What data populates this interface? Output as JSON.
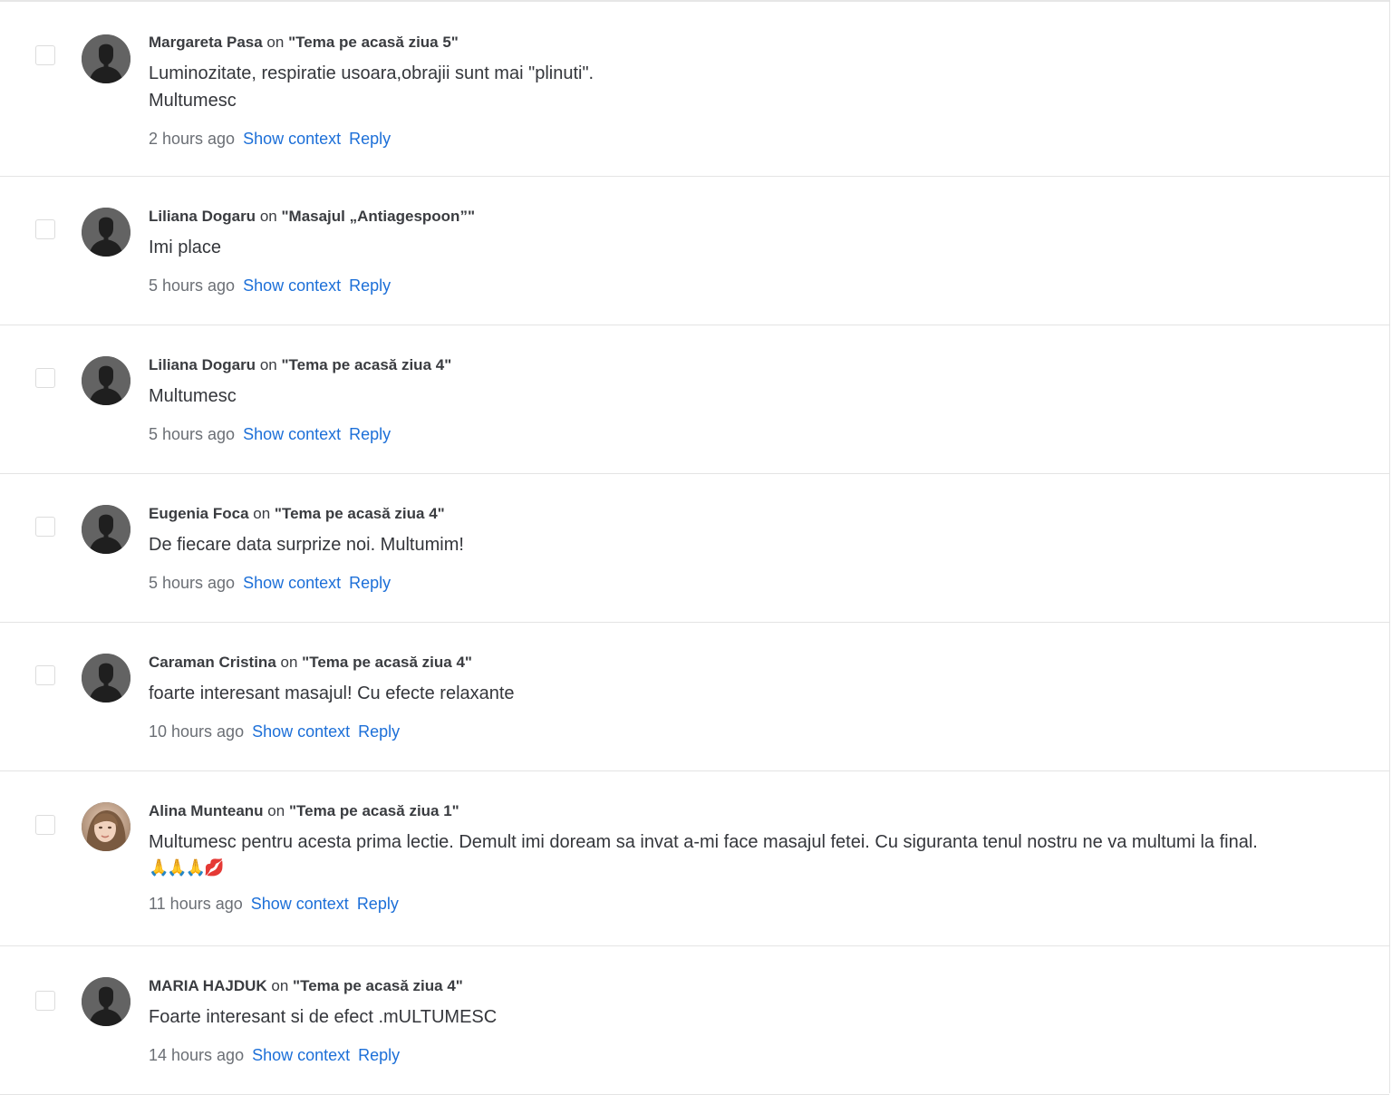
{
  "comments": [
    {
      "author": "Margareta Pasa",
      "on": "on",
      "post": "\"Tema pe acasă ziua 5\"",
      "text_lines": [
        "Luminozitate, respiratie usoara,obrajii sunt mai \"plinuti\".",
        "Multumesc"
      ],
      "time": "2 hours ago",
      "show_context": "Show context",
      "reply": "Reply",
      "avatar": "default-silhouette"
    },
    {
      "author": "Liliana Dogaru",
      "on": "on",
      "post": "\"Masajul „Antiagespoon”\"",
      "text_lines": [
        "Imi place"
      ],
      "time": "5 hours ago",
      "show_context": "Show context",
      "reply": "Reply",
      "avatar": "default-silhouette"
    },
    {
      "author": "Liliana Dogaru",
      "on": "on",
      "post": "\"Tema pe acasă ziua 4\"",
      "text_lines": [
        "Multumesc"
      ],
      "time": "5 hours ago",
      "show_context": "Show context",
      "reply": "Reply",
      "avatar": "default-silhouette"
    },
    {
      "author": "Eugenia Foca",
      "on": "on",
      "post": "\"Tema pe acasă ziua 4\"",
      "text_lines": [
        "De fiecare data surprize noi. Multumim!"
      ],
      "time": "5 hours ago",
      "show_context": "Show context",
      "reply": "Reply",
      "avatar": "default-silhouette"
    },
    {
      "author": "Caraman Cristina",
      "on": "on",
      "post": "\"Tema pe acasă ziua 4\"",
      "text_lines": [
        "foarte interesant masajul! Cu efecte relaxante"
      ],
      "time": "10 hours ago",
      "show_context": "Show context",
      "reply": "Reply",
      "avatar": "default-silhouette"
    },
    {
      "author": "Alina Munteanu",
      "on": "on",
      "post": "\"Tema pe acasă ziua 1\"",
      "text_lines": [
        "Multumesc pentru acesta prima lectie. Demult imi doream sa invat a-mi face masajul fetei. Cu siguranta tenul nostru ne va multumi la final."
      ],
      "emoji_line": "🙏🙏🙏💋",
      "time": "11 hours ago",
      "show_context": "Show context",
      "reply": "Reply",
      "avatar": "photo"
    },
    {
      "author": "MARIA HAJDUK",
      "on": "on",
      "post": "\"Tema pe acasă ziua 4\"",
      "text_lines": [
        "Foarte interesant si de efect .mULTUMESC"
      ],
      "time": "14 hours ago",
      "show_context": "Show context",
      "reply": "Reply",
      "avatar": "default-silhouette"
    }
  ],
  "colors": {
    "link": "#1c6fd8",
    "text": "#34363b",
    "muted": "#6b6f75",
    "divider": "#e4e4e4",
    "avatar_bg": "#636363"
  }
}
